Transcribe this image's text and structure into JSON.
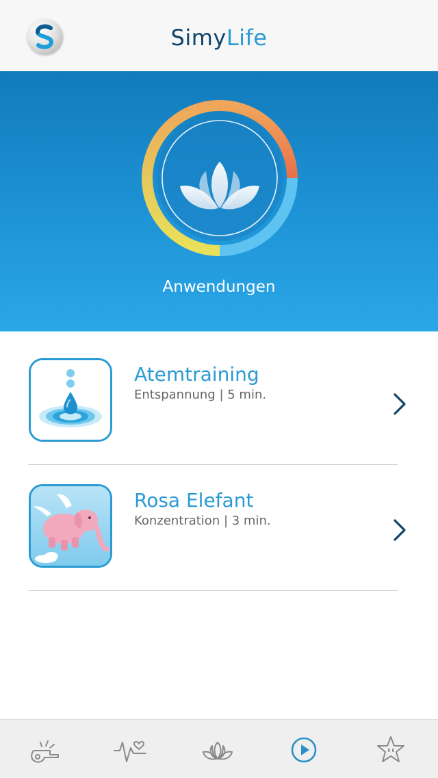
{
  "header": {
    "title_part1": "Simy",
    "title_part2": "Life",
    "logo_icon": "simylife-s-logo-icon"
  },
  "hero": {
    "label": "Anwendungen",
    "icon": "lotus-icon",
    "ring_colors": [
      "#f0a65a",
      "#e96f4c",
      "#5fc3f2",
      "#e8e25a"
    ]
  },
  "exercises": [
    {
      "title": "Atemtraining",
      "subtitle": "Entspannung | 5 min.",
      "icon": "water-drop-icon"
    },
    {
      "title": "Rosa Elefant",
      "subtitle": "Konzentration | 3 min.",
      "icon": "pink-elephant-icon"
    }
  ],
  "tabbar": {
    "items": [
      {
        "icon": "whistle-icon",
        "active": false
      },
      {
        "icon": "heartbeat-icon",
        "active": false
      },
      {
        "icon": "lotus-icon",
        "active": false
      },
      {
        "icon": "play-circle-icon",
        "active": true
      },
      {
        "icon": "star-icon",
        "active": false
      }
    ]
  },
  "colors": {
    "accent": "#2a9ad3",
    "brand_dark": "#10446b",
    "active_tab": "#2a8fcb",
    "inactive_tab": "#8a8a8a"
  }
}
